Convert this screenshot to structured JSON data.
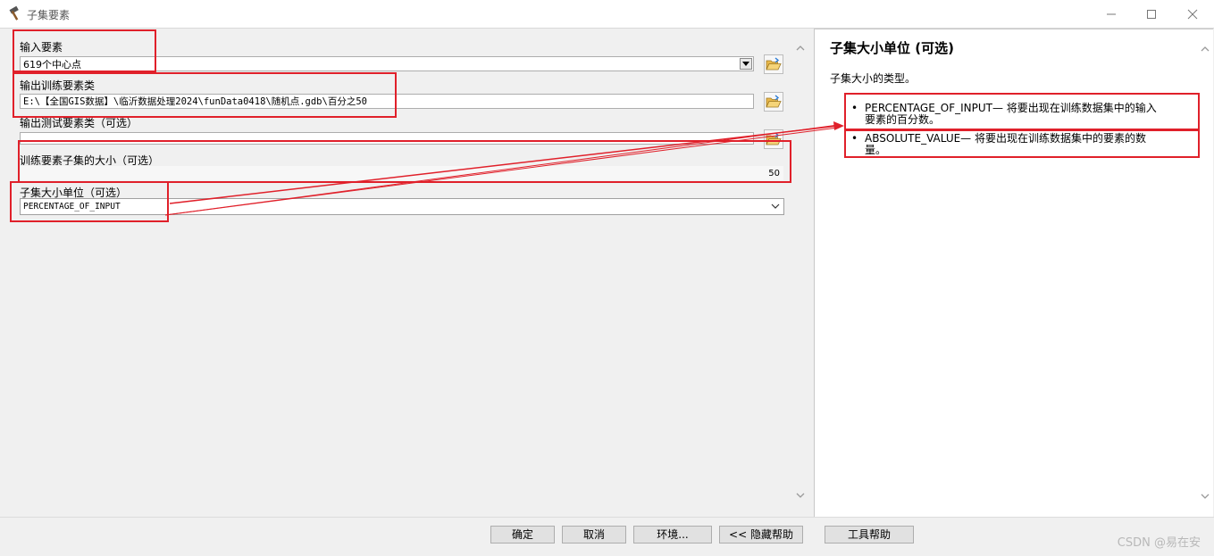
{
  "window": {
    "title": "子集要素",
    "icons": {
      "app": "hammer-icon",
      "minimize": "minimize-icon",
      "maximize": "maximize-icon",
      "close": "close-icon"
    }
  },
  "form": {
    "input_label": "输入要素",
    "input_value": "619个中心点",
    "output_train_label": "输出训练要素类",
    "output_train_value": "E:\\【全国GIS数据】\\临沂数据处理2024\\funData0418\\随机点.gdb\\百分之50",
    "output_test_label": "输出测试要素类（可选）",
    "output_test_value": "",
    "subset_size_label": "训练要素子集的大小（可选）",
    "subset_size_value": "50",
    "subset_unit_label": "子集大小单位（可选）",
    "subset_unit_value": "PERCENTAGE_OF_INPUT"
  },
  "help": {
    "title": "子集大小单位 (可选)",
    "description": "子集大小的类型。",
    "items": [
      {
        "line1": "PERCENTAGE_OF_INPUT— 将要出现在训练数据集中的输入",
        "line2": "要素的百分数。"
      },
      {
        "line1": "ABSOLUTE_VALUE— 将要出现在训练数据集中的要素的数",
        "line2": "量。"
      }
    ]
  },
  "buttons": {
    "ok": "确定",
    "cancel": "取消",
    "env": "环境...",
    "hide_help": "<< 隐藏帮助",
    "tool_help": "工具帮助"
  },
  "watermark": "CSDN @易在安",
  "colors": {
    "annotation": "#e0202a",
    "panel": "#f0f0f0",
    "help_bg": "#ffffff"
  }
}
